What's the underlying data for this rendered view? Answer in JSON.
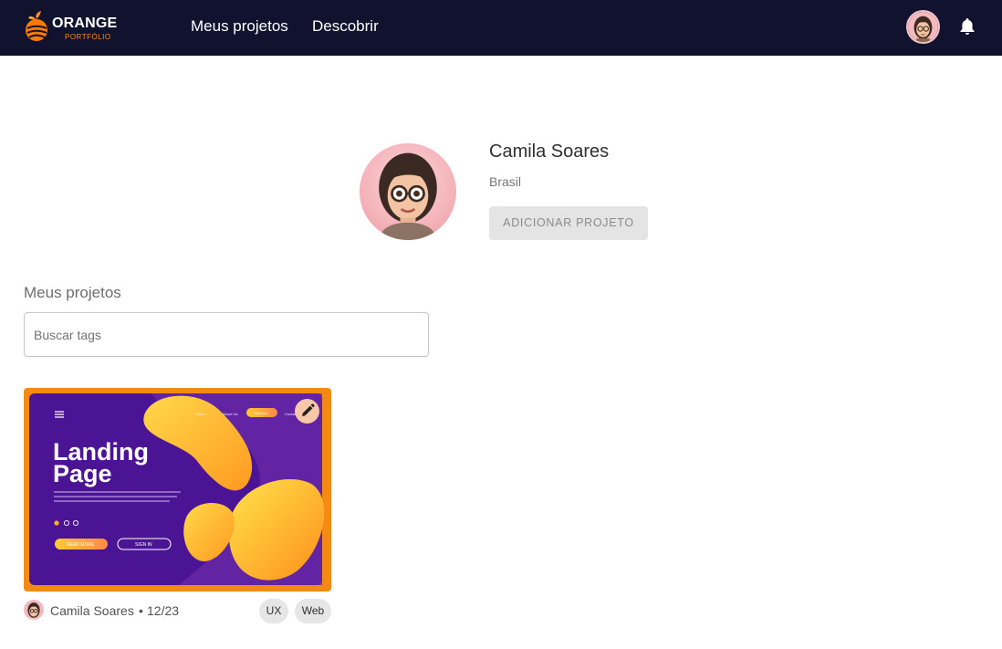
{
  "header": {
    "logo": {
      "title": "ORANGE",
      "subtitle": "PORTFÓLIO",
      "icon": "orange-fruit-logo"
    },
    "nav": {
      "projects": "Meus projetos",
      "discover": "Descobrir"
    },
    "avatar_icon": "user-avatar",
    "notifications_icon": "bell-icon"
  },
  "profile": {
    "name": "Camila Soares",
    "country": "Brasil",
    "add_button": "ADICIONAR PROJETO"
  },
  "projects": {
    "section_title": "Meus projetos",
    "search": {
      "placeholder": "Buscar tags",
      "value": ""
    },
    "items": [
      {
        "thumbnail": {
          "heading_line1": "Landing",
          "heading_line2": "Page",
          "read_more": "READ MORE",
          "sign_in": "SIGN IN",
          "nav_about": "About Us",
          "nav_cta": "Services",
          "nav_home": "Home",
          "nav_contact": "Contact"
        },
        "edit_icon": "pencil-icon",
        "author": "Camila Soares",
        "separator": "•",
        "date": "12/23",
        "tags": [
          "UX",
          "Web"
        ]
      }
    ]
  },
  "colors": {
    "header_bg": "#11132e",
    "accent_orange": "#ff8a1e",
    "thumbnail_purple": "#4b1494",
    "button_disabled_bg": "#e4e4e4"
  }
}
